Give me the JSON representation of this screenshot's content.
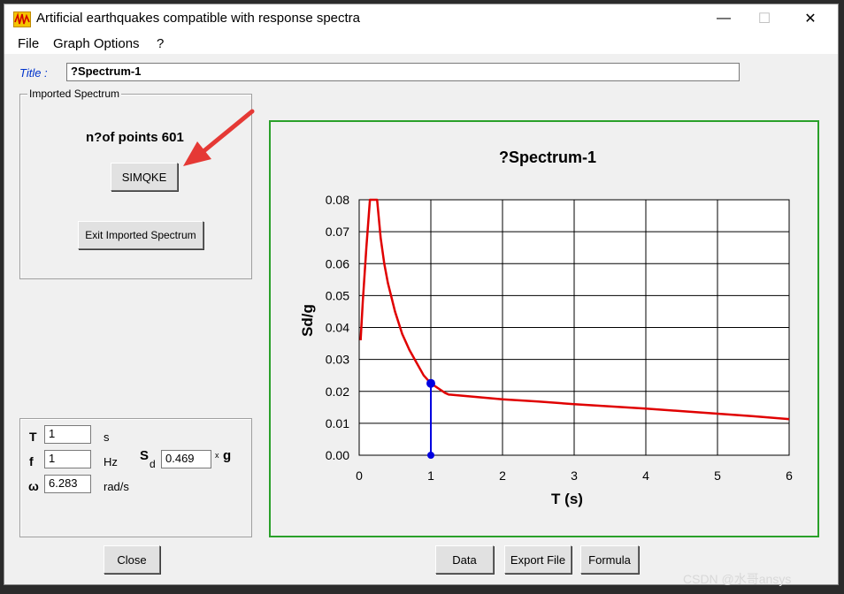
{
  "window": {
    "title": "Artificial earthquakes compatible with response spectra",
    "minimize": "—",
    "maximize": "☐",
    "close": "✕"
  },
  "menu": {
    "items": [
      "File",
      "Graph Options",
      "?"
    ]
  },
  "title_field": {
    "label": "Title :",
    "value": "?Spectrum-1"
  },
  "imported_spectrum": {
    "group_label": "Imported Spectrum",
    "points_text": "n?of points 601",
    "simqke_button": "SIMQKE",
    "exit_button": "Exit Imported Spectrum"
  },
  "params": {
    "T": {
      "label": "T",
      "value": "1",
      "unit": "s"
    },
    "f": {
      "label": "f",
      "value": "1",
      "unit": "Hz"
    },
    "omega": {
      "label": "ω",
      "value": "6.283",
      "unit": "rad/s"
    },
    "sd": {
      "label": "S",
      "sub": "d",
      "value": "0.469",
      "unit_prefix": "x",
      "unit": "g"
    }
  },
  "buttons": {
    "close": "Close",
    "data": "Data",
    "export": "Export File",
    "formula": "Formula"
  },
  "watermark": "CSDN @水哥ansys",
  "colors": {
    "curve": "#e00000",
    "marker": "#0000e0",
    "frame": "#2aa02a",
    "arrow": "#e53935"
  },
  "chart_data": {
    "type": "line",
    "title": "?Spectrum-1",
    "xlabel": "T (s)",
    "ylabel": "Sd/g",
    "xlim": [
      0,
      6
    ],
    "ylim": [
      0,
      0.08
    ],
    "xticks": [
      "0",
      "1",
      "2",
      "3",
      "4",
      "5",
      "6"
    ],
    "yticks": [
      "0.00",
      "0.01",
      "0.02",
      "0.03",
      "0.04",
      "0.05",
      "0.06",
      "0.07",
      "0.08"
    ],
    "grid": true,
    "series": [
      {
        "x": [
          0.02,
          0.05,
          0.1,
          0.15,
          0.2,
          0.25,
          0.3,
          0.35,
          0.4,
          0.5,
          0.6,
          0.7,
          0.8,
          0.9,
          1.0,
          1.1,
          1.2,
          1.25,
          1.5,
          2,
          2.5,
          3,
          3.5,
          4,
          4.5,
          5,
          5.5,
          6
        ],
        "y": [
          0.036,
          0.048,
          0.065,
          0.08,
          0.08,
          0.08,
          0.068,
          0.06,
          0.054,
          0.045,
          0.038,
          0.033,
          0.029,
          0.025,
          0.0225,
          0.021,
          0.0195,
          0.019,
          0.0185,
          0.0175,
          0.0168,
          0.016,
          0.0153,
          0.0146,
          0.0138,
          0.013,
          0.0122,
          0.0113
        ]
      }
    ],
    "marker": {
      "x": 1,
      "y": 0.0225
    }
  }
}
